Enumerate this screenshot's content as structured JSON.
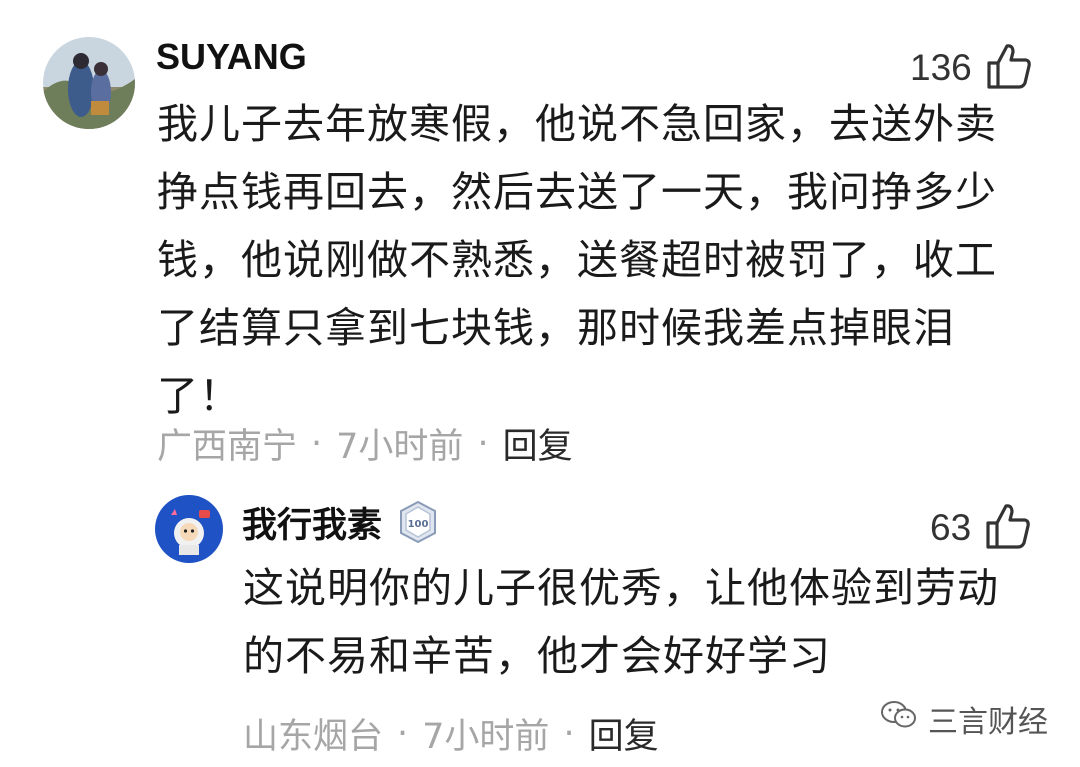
{
  "comments": [
    {
      "username": "SUYANG",
      "likes": "136",
      "text": "我儿子去年放寒假，他说不急回家，去送外卖挣点钱再回去，然后去送了一天，我问挣多少钱，他说刚做不熟悉，送餐超时被罚了，收工了结算只拿到七块钱，那时候我差点掉眼泪了！",
      "location": "广西南宁",
      "time": "7小时前",
      "reply_label": "回复"
    },
    {
      "username": "我行我素",
      "badge": "100",
      "likes": "63",
      "text": "这说明你的儿子很优秀，让他体验到劳动的不易和辛苦，他才会好好学习",
      "location": "山东烟台",
      "time": "7小时前",
      "reply_label": "回复"
    }
  ],
  "separator": "·",
  "watermark": "三言财经",
  "icons": {
    "like": "thumbs-up-icon",
    "badge": "level-badge-icon",
    "watermark": "wechat-icon"
  }
}
